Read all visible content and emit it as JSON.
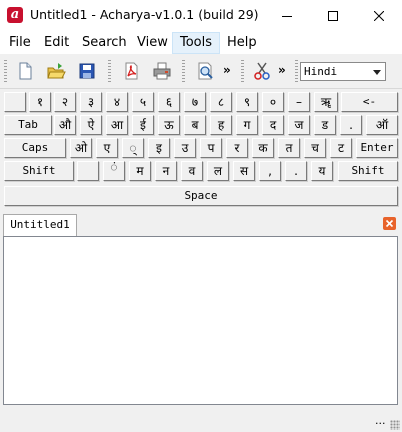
{
  "window": {
    "title": "Untitled1 - Acharya-v1.0.1 (build 29)",
    "icon_letter": "a"
  },
  "menu": {
    "items": [
      "File",
      "Edit",
      "Search",
      "View",
      "Tools",
      "Help"
    ],
    "active": "Tools"
  },
  "toolbar": {
    "buttons": [
      "new-file-icon",
      "open-folder-icon",
      "save-icon",
      "pdf-icon",
      "print-icon",
      "zoom-icon",
      "cut-icon"
    ],
    "overflow": "»",
    "language": "Hindi"
  },
  "keyboard": {
    "row1": [
      "",
      "१",
      "२",
      "३",
      "४",
      "५",
      "६",
      "७",
      "८",
      "९",
      "०",
      "–",
      "ॠ",
      "<-"
    ],
    "row2": [
      "Tab",
      "औ",
      "ऐ",
      "आ",
      "ई",
      "ऊ",
      "ब",
      "ह",
      "ग",
      "द",
      "ज",
      "ड",
      ".",
      "ऑ"
    ],
    "row3": [
      "Caps",
      "ओ",
      "ए",
      "्",
      "इ",
      "उ",
      "प",
      "र",
      "क",
      "त",
      "च",
      "ट",
      "Enter"
    ],
    "row4": [
      "Shift",
      "",
      "ं",
      "म",
      "न",
      "व",
      "ल",
      "स",
      ",",
      ".",
      "य",
      "Shift"
    ],
    "space": "Space"
  },
  "tabs": [
    {
      "label": "Untitled1"
    }
  ],
  "editor": {
    "content": ""
  },
  "status": {
    "text": "..."
  }
}
